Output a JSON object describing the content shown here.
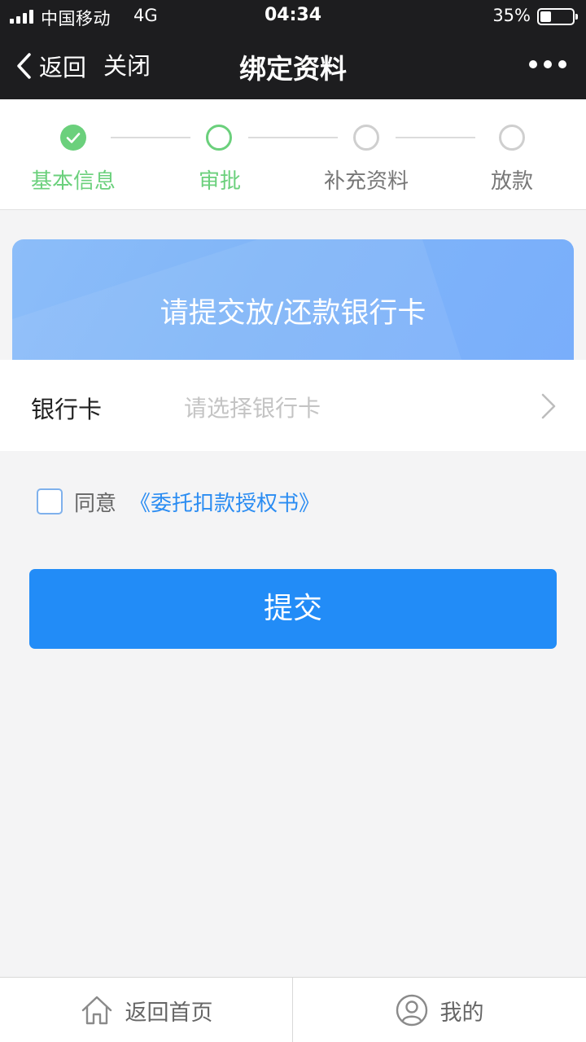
{
  "status_bar": {
    "carrier": "中国移动",
    "network": "4G",
    "time": "04:34",
    "battery_percent": "35%",
    "battery_level": 0.35
  },
  "nav": {
    "back_label": "返回",
    "close_label": "关闭",
    "title": "绑定资料",
    "more_icon": "more-dots-icon"
  },
  "steps": [
    {
      "label": "基本信息",
      "state": "done"
    },
    {
      "label": "审批",
      "state": "current"
    },
    {
      "label": "补充资料",
      "state": "pending"
    },
    {
      "label": "放款",
      "state": "pending"
    }
  ],
  "colors": {
    "step_active": "#6bd07c",
    "step_pending": "#c9c9c9",
    "primary": "#228cf7",
    "link": "#2a8cf2",
    "nav_bg": "#1d1d1f"
  },
  "banner": {
    "title": "请提交放/还款银行卡"
  },
  "bank_card": {
    "label": "银行卡",
    "placeholder": "请选择银行卡"
  },
  "agreement": {
    "checked": false,
    "text": "同意",
    "link_text": "《委托扣款授权书》"
  },
  "submit_label": "提交",
  "tabbar": {
    "home": {
      "label": "返回首页",
      "icon": "home-icon"
    },
    "mine": {
      "label": "我的",
      "icon": "user-icon"
    }
  }
}
